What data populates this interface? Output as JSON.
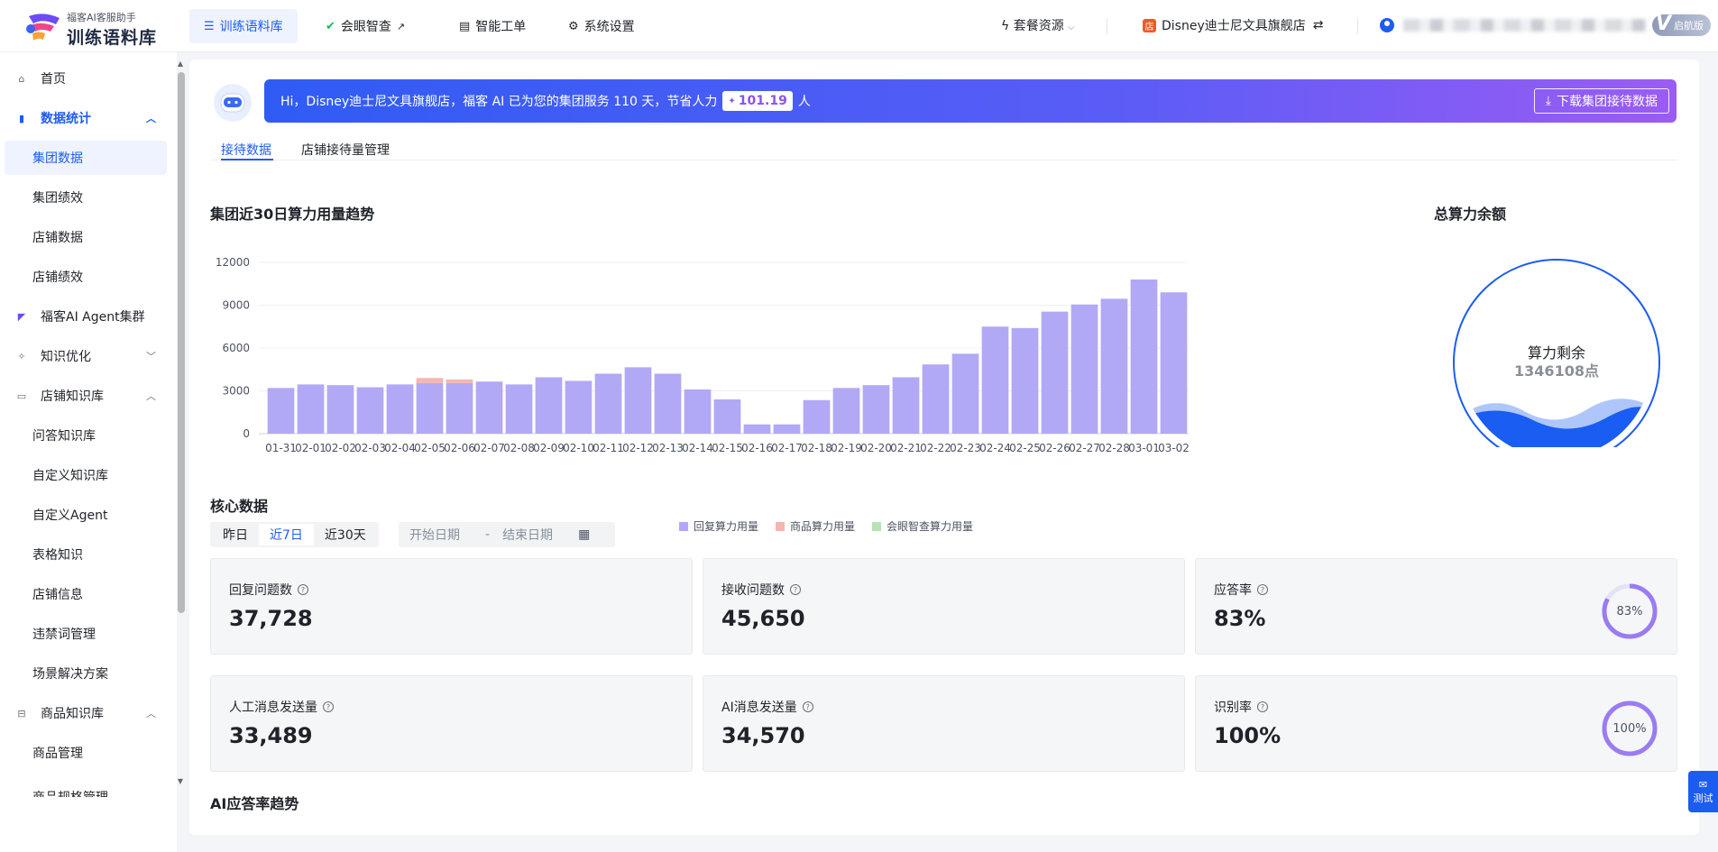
{
  "app": {
    "logo_sub": "福客AI客服助手",
    "logo_main": "训练语料库"
  },
  "topnav": {
    "items": [
      {
        "label": "训练语料库",
        "icon": "database-icon"
      },
      {
        "label": "会眼智查",
        "icon": "check-circle-icon"
      },
      {
        "label": "智能工单",
        "icon": "ticket-icon"
      },
      {
        "label": "系统设置",
        "icon": "gear-icon"
      }
    ],
    "package_label": "套餐资源",
    "store_name": "Disney迪士尼文具旗舰店",
    "version_label": "启航版"
  },
  "sidebar": {
    "items": [
      {
        "label": "首页",
        "type": "group"
      },
      {
        "label": "数据统计",
        "type": "group"
      },
      {
        "label": "集团数据",
        "type": "sub"
      },
      {
        "label": "集团绩效",
        "type": "sub"
      },
      {
        "label": "店铺数据",
        "type": "sub"
      },
      {
        "label": "店铺绩效",
        "type": "sub"
      },
      {
        "label": "福客AI Agent集群",
        "type": "group"
      },
      {
        "label": "知识优化",
        "type": "group"
      },
      {
        "label": "店铺知识库",
        "type": "group"
      },
      {
        "label": "问答知识库",
        "type": "sub"
      },
      {
        "label": "自定义知识库",
        "type": "sub"
      },
      {
        "label": "自定义Agent",
        "type": "sub"
      },
      {
        "label": "表格知识",
        "type": "sub"
      },
      {
        "label": "店铺信息",
        "type": "sub"
      },
      {
        "label": "违禁词管理",
        "type": "sub"
      },
      {
        "label": "场景解决方案",
        "type": "sub"
      },
      {
        "label": "商品知识库",
        "type": "group"
      },
      {
        "label": "商品管理",
        "type": "sub"
      },
      {
        "label": "商品规格管理",
        "type": "sub"
      }
    ]
  },
  "banner": {
    "text_before": "Hi，Disney迪士尼文具旗舰店，福客 AI 已为您的集团服务 110 天，节省人力",
    "highlight": "101.19",
    "text_after": "人",
    "download_label": "下载集团接待数据"
  },
  "tabs": [
    "接待数据",
    "店铺接待量管理"
  ],
  "trend": {
    "title": "集团近30日算力用量趋势"
  },
  "balance": {
    "title": "总算力余额",
    "label": "算力剩余",
    "value": "1346108点",
    "wave_color": "#1a5df2"
  },
  "chart_data": {
    "type": "bar",
    "stacked": true,
    "categories": [
      "01-31",
      "02-01",
      "02-02",
      "02-03",
      "02-04",
      "02-05",
      "02-06",
      "02-07",
      "02-08",
      "02-09",
      "02-10",
      "02-11",
      "02-12",
      "02-13",
      "02-14",
      "02-15",
      "02-16",
      "02-17",
      "02-18",
      "02-19",
      "02-20",
      "02-21",
      "02-22",
      "02-23",
      "02-24",
      "02-25",
      "02-26",
      "02-27",
      "02-28",
      "03-01",
      "03-02"
    ],
    "series": [
      {
        "name": "回复算力用量",
        "color": "#b1a9f5",
        "values": [
          3200,
          3450,
          3400,
          3250,
          3450,
          3550,
          3550,
          3650,
          3450,
          3950,
          3700,
          4200,
          4650,
          4200,
          3100,
          2400,
          650,
          650,
          2350,
          3200,
          3400,
          3950,
          4850,
          5600,
          7500,
          7400,
          8550,
          9050,
          9450,
          10800,
          9900
        ]
      },
      {
        "name": "商品算力用量",
        "color": "#f4b6b0",
        "values": [
          0,
          0,
          0,
          0,
          0,
          350,
          250,
          0,
          0,
          0,
          0,
          0,
          0,
          0,
          0,
          0,
          0,
          0,
          0,
          0,
          0,
          0,
          0,
          0,
          0,
          0,
          0,
          0,
          0,
          0,
          0
        ]
      },
      {
        "name": "会眼智查算力用量",
        "color": "#b7e4b5",
        "values": [
          0,
          0,
          0,
          0,
          0,
          0,
          0,
          0,
          0,
          0,
          0,
          0,
          0,
          0,
          0,
          0,
          0,
          0,
          0,
          0,
          0,
          0,
          0,
          0,
          0,
          0,
          0,
          0,
          0,
          0,
          0
        ]
      }
    ],
    "yticks": [
      "0",
      "3000",
      "6000",
      "9000",
      "12000"
    ],
    "ylim": [
      0,
      12000
    ],
    "grid": true,
    "legend": "bottom"
  },
  "core": {
    "title": "核心数据",
    "ranges": [
      "昨日",
      "近7日",
      "近30天"
    ],
    "active_range": "近7日",
    "start_placeholder": "开始日期",
    "end_placeholder": "结束日期",
    "range_sep": "-",
    "cards": [
      {
        "label": "回复问题数",
        "value": "37,728"
      },
      {
        "label": "接收问题数",
        "value": "45,650"
      },
      {
        "label": "应答率",
        "value": "83%",
        "ring": 0.83,
        "ring_label": "83%"
      },
      {
        "label": "人工消息发送量",
        "value": "33,489"
      },
      {
        "label": "AI消息发送量",
        "value": "34,570"
      },
      {
        "label": "识别率",
        "value": "100%",
        "ring": 1.0,
        "ring_label": "100%"
      }
    ]
  },
  "ai_trend": {
    "title": "AI应答率趋势"
  },
  "float_button": {
    "label": "测试"
  },
  "colors": {
    "primary": "#1d5cf0",
    "ring": "#9a7cf2",
    "ring_track": "#e4e2f7"
  }
}
